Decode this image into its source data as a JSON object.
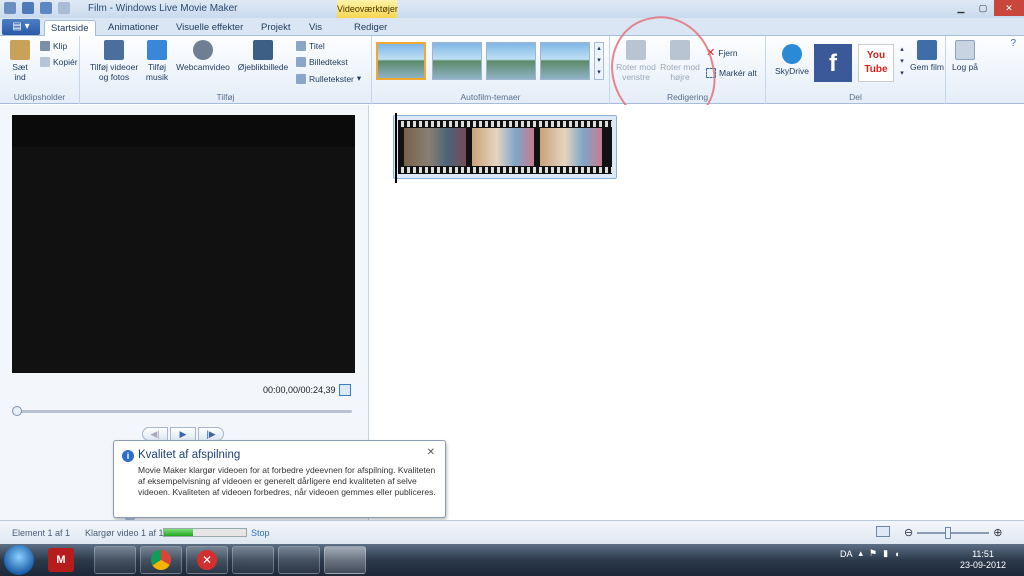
{
  "window": {
    "title": "Film - Windows Live Movie Maker",
    "context_tab_header": "Videoværktøjer"
  },
  "tabs": [
    "Startside",
    "Animationer",
    "Visuelle effekter",
    "Projekt",
    "Vis",
    "Rediger"
  ],
  "ribbon": {
    "clipboard": {
      "paste": "Sæt ind",
      "cut": "Klip",
      "copy": "Kopiér",
      "label": "Udklipsholder"
    },
    "add": {
      "add_videos": "Tilføj videoer og fotos",
      "add_music": "Tilføj musik",
      "webcam": "Webcamvideo",
      "snapshot": "Øjeblikbillede",
      "title": "Titel",
      "caption": "Billedtekst",
      "credits": "Rulletekster",
      "label": "Tilføj"
    },
    "autofilm": {
      "label": "Autofilm-temaer"
    },
    "editing": {
      "rotate_left": "Roter mod venstre",
      "rotate_right": "Roter mod højre",
      "remove": "Fjern",
      "select_all": "Markér alt",
      "label": "Redigering"
    },
    "share": {
      "skydrive": "SkyDrive",
      "youtube": "You Tube",
      "save_movie": "Gem film",
      "sign_in": "Log på",
      "label": "Del"
    }
  },
  "preview": {
    "timecode": "00:00,00/00:24,39",
    "seek_fraction": 0
  },
  "tooltip": {
    "title": "Kvalitet af afspilning",
    "body": "Movie Maker klargør videoen for at forbedre ydeevnen for afspilning. Kvaliteten af eksempelvisning af videoen er generelt dårligere end kvaliteten af selve videoen. Kvaliteten af videoen forbedres, når videoen gemmes eller publiceres."
  },
  "status": {
    "element": "Element 1 af 1",
    "preparing": "Klargør video 1 af 1",
    "progress": 0.35,
    "stop": "Stop"
  },
  "taskbar": {
    "lang": "DA",
    "time": "11:51",
    "date": "23-09-2012"
  }
}
